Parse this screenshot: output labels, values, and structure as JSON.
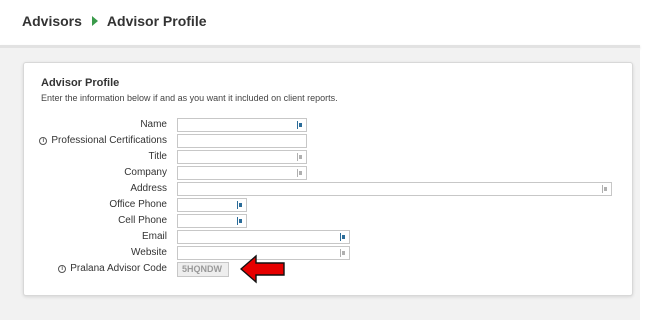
{
  "breadcrumb": {
    "items": [
      "Advisors",
      "Advisor Profile"
    ]
  },
  "card": {
    "title": "Advisor Profile",
    "description": "Enter the information below if and as you want it included on client reports."
  },
  "fields": {
    "name": {
      "label": "Name",
      "value": ""
    },
    "certifications": {
      "label": "Professional Certifications",
      "value": ""
    },
    "title": {
      "label": "Title",
      "value": ""
    },
    "company": {
      "label": "Company",
      "value": ""
    },
    "address": {
      "label": "Address",
      "value": ""
    },
    "office_phone": {
      "label": "Office Phone",
      "value": ""
    },
    "cell_phone": {
      "label": "Cell Phone",
      "value": ""
    },
    "email": {
      "label": "Email",
      "value": ""
    },
    "website": {
      "label": "Website",
      "value": ""
    },
    "advisor_code": {
      "label": "Pralana Advisor Code",
      "value": "5HQNDW"
    }
  },
  "icons": {
    "breadcrumb_separator": "triangle-right-icon",
    "field_info": "info-circle-icon",
    "autofill": "autofill-icon",
    "callout": "red-arrow-left"
  },
  "colors": {
    "accent_green": "#3a9a4a",
    "autofill_blue": "#2b6c99",
    "arrow_red": "#e60000"
  }
}
